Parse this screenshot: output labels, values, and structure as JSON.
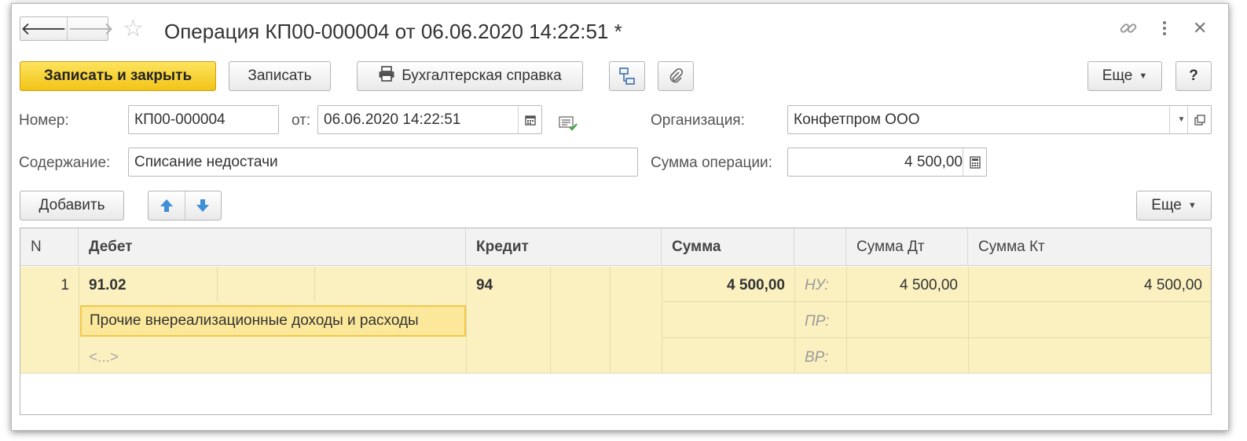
{
  "window": {
    "title": "Операция КП00-000004 от 06.06.2020 14:22:51 *",
    "nav_back": "🡐",
    "nav_forward": "🡒",
    "link_icon": "link-icon",
    "more_icon": "vertical-dots-icon",
    "close_icon": "close-icon"
  },
  "toolbar": {
    "save_close_label": "Записать и закрыть",
    "save_label": "Записать",
    "report_label": "Бухгалтерская справка",
    "more_label": "Еще",
    "help_label": "?"
  },
  "form": {
    "number_label": "Номер:",
    "number_value": "КП00-000004",
    "date_label": "от:",
    "date_value": "06.06.2020 14:22:51",
    "org_label": "Организация:",
    "org_value": "Конфетпром ООО",
    "content_label": "Содержание:",
    "content_value": "Списание недостачи",
    "sum_label": "Сумма операции:",
    "sum_value": "4 500,00"
  },
  "table_toolbar": {
    "add_label": "Добавить",
    "more_label": "Еще"
  },
  "table": {
    "headers": {
      "n": "N",
      "debit": "Дебет",
      "credit": "Кредит",
      "sum": "Сумма",
      "sum_dt": "Сумма Дт",
      "sum_kt": "Сумма Кт"
    },
    "rows": [
      {
        "n": "1",
        "debit_account": "91.02",
        "debit_subconto": "Прочие внереализационные доходы и расходы",
        "debit_placeholder": "<...>",
        "credit_account": "94",
        "sum": "4 500,00",
        "types": [
          "НУ:",
          "ПР:",
          "ВР:"
        ],
        "sum_dt": "4 500,00",
        "sum_kt": "4 500,00"
      }
    ]
  },
  "colors": {
    "primary_button": "#f5c918",
    "row_highlight": "#fbf0c0",
    "nav_arrow_blue": "#3d8fd8"
  }
}
